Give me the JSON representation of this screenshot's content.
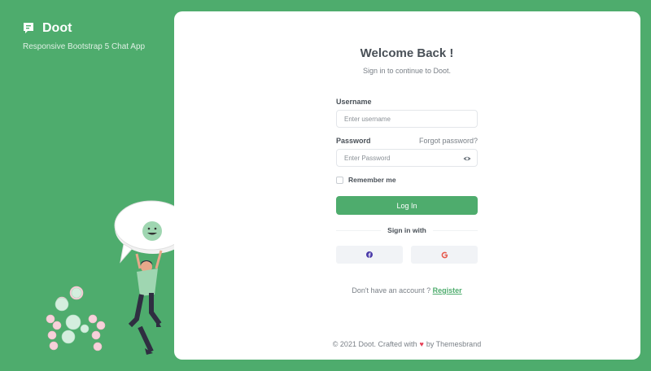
{
  "brand": {
    "name": "Doot",
    "tagline": "Responsive Bootstrap 5 Chat App",
    "icon": "chat-bubble-icon"
  },
  "form": {
    "title": "Welcome Back !",
    "subtitle": "Sign in to continue to Doot.",
    "username_label": "Username",
    "username_placeholder": "Enter username",
    "password_label": "Password",
    "forgot_label": "Forgot password?",
    "password_placeholder": "Enter Password",
    "remember_label": "Remember me",
    "login_label": "Log In",
    "signin_with": "Sign in with",
    "social": [
      "facebook-icon",
      "google-icon"
    ]
  },
  "signup": {
    "prompt": "Don't have an account ?",
    "link": "Register"
  },
  "footer": {
    "prefix": "© 2021 Doot. Crafted with",
    "suffix": "by Themesbrand"
  },
  "colors": {
    "brand_green": "#4eac6d",
    "heart": "#e63f56",
    "facebook": "#4a3aa8",
    "google": "#e6584b"
  }
}
